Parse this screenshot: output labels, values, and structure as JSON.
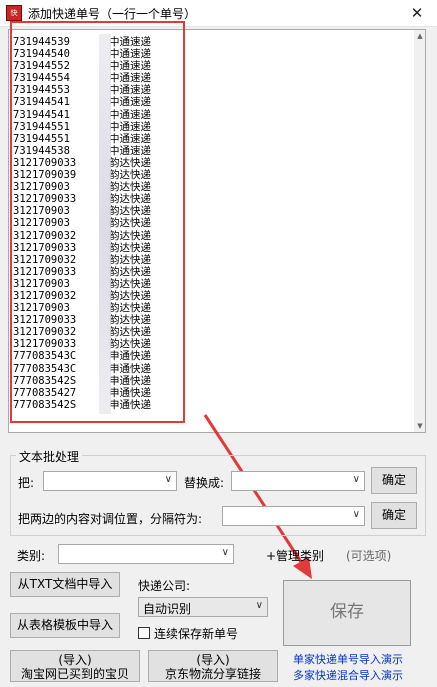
{
  "window": {
    "title": "添加快递单号（一行一个单号）",
    "app_icon": "app-logo-icon",
    "close_icon": "close-icon",
    "close_glyph": "✕"
  },
  "tracking_list": [
    {
      "number": "731944539",
      "courier": "中通速递"
    },
    {
      "number": "731944540",
      "courier": "中通速递"
    },
    {
      "number": "731944552",
      "courier": "中通速递"
    },
    {
      "number": "731944554",
      "courier": "中通速递"
    },
    {
      "number": "731944553",
      "courier": "中通速递"
    },
    {
      "number": "731944541",
      "courier": "中通速递"
    },
    {
      "number": "731944541",
      "courier": "中通速递"
    },
    {
      "number": "731944551",
      "courier": "中通速递"
    },
    {
      "number": "731944551",
      "courier": "中通速递"
    },
    {
      "number": "731944538",
      "courier": "中通速递"
    },
    {
      "number": "3121709033",
      "courier": "韵达快递"
    },
    {
      "number": "3121709039",
      "courier": "韵达快递"
    },
    {
      "number": "312170903",
      "courier": "韵达快递"
    },
    {
      "number": "3121709033",
      "courier": "韵达快递"
    },
    {
      "number": "312170903",
      "courier": "韵达快递"
    },
    {
      "number": "312170903",
      "courier": "韵达快递"
    },
    {
      "number": "3121709032",
      "courier": "韵达快递"
    },
    {
      "number": "3121709033",
      "courier": "韵达快递"
    },
    {
      "number": "3121709032",
      "courier": "韵达快递"
    },
    {
      "number": "3121709033",
      "courier": "韵达快递"
    },
    {
      "number": "312170903",
      "courier": "韵达快递"
    },
    {
      "number": "3121709032",
      "courier": "韵达快递"
    },
    {
      "number": "312170903",
      "courier": "韵达快递"
    },
    {
      "number": "3121709033",
      "courier": "韵达快递"
    },
    {
      "number": "3121709032",
      "courier": "韵达快递"
    },
    {
      "number": "3121709033",
      "courier": "韵达快递"
    },
    {
      "number": "777083543C",
      "courier": "申通快递"
    },
    {
      "number": "777083543C",
      "courier": "申通快递"
    },
    {
      "number": "777083542S",
      "courier": "申通快递"
    },
    {
      "number": "7770835427",
      "courier": "申通快递"
    },
    {
      "number": "777083542S",
      "courier": "申通快递"
    }
  ],
  "batch": {
    "group_title": "文本批处理",
    "replace_from_label": "把:",
    "replace_to_label": "替换成:",
    "confirm_label": "确定",
    "swap_label": "把两边的内容对调位置，分隔符为:",
    "swap_confirm_label": "确定"
  },
  "category": {
    "label": "类别:",
    "manage_label": "+管理类别",
    "optional_label": "(可选项)"
  },
  "import": {
    "txt_label": "从TXT文档中导入",
    "template_label": "从表格模板中导入"
  },
  "courier": {
    "label": "快递公司:",
    "selected": "自动识别"
  },
  "continue_save": {
    "label": "连续保存新单号",
    "checked": false
  },
  "save_label": "保存",
  "bottom": {
    "taobao_line1": "(导入)",
    "taobao_line2": "淘宝网已买到的宝贝",
    "jd_line1": "(导入)",
    "jd_line2": "京东物流分享链接",
    "demo1": "单家快递单号导入演示",
    "demo2": "多家快递混合导入演示"
  },
  "colors": {
    "annotation_red": "#e03a3a",
    "link_blue": "#0033cc"
  }
}
